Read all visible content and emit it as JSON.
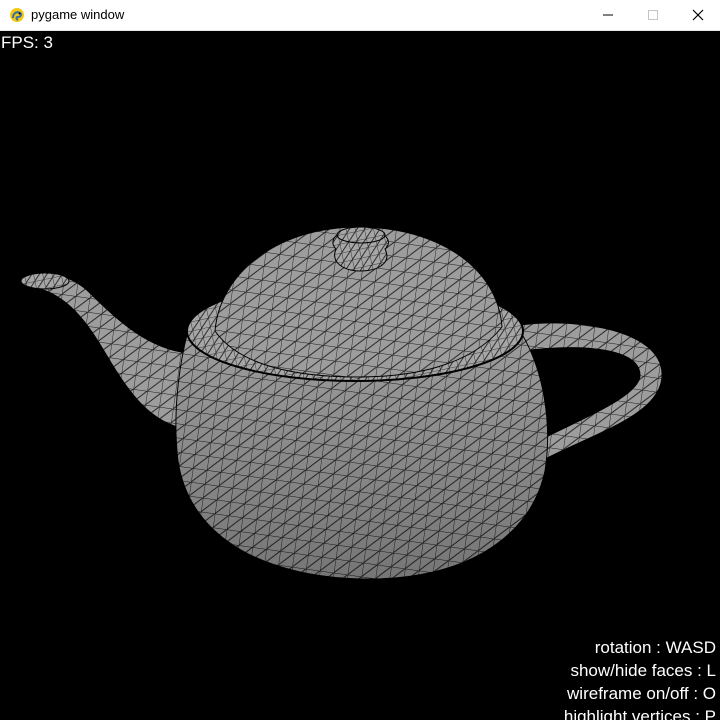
{
  "window": {
    "title": "pygame window",
    "icon": "pygame-snake-icon",
    "controls": {
      "minimize_icon": "minimize-icon",
      "maximize_icon": "maximize-icon",
      "close_icon": "close-icon"
    }
  },
  "hud": {
    "fps_label": "FPS: 3",
    "help": [
      "rotation : WASD",
      "show/hide faces : L",
      "wireframe on/off : O",
      "highlight vertices : P"
    ]
  },
  "scene": {
    "object": "teapot",
    "background_color": "#000000",
    "face_color": "#9a9a9a",
    "wire_color": "#000000",
    "text_color": "#ffffff"
  }
}
